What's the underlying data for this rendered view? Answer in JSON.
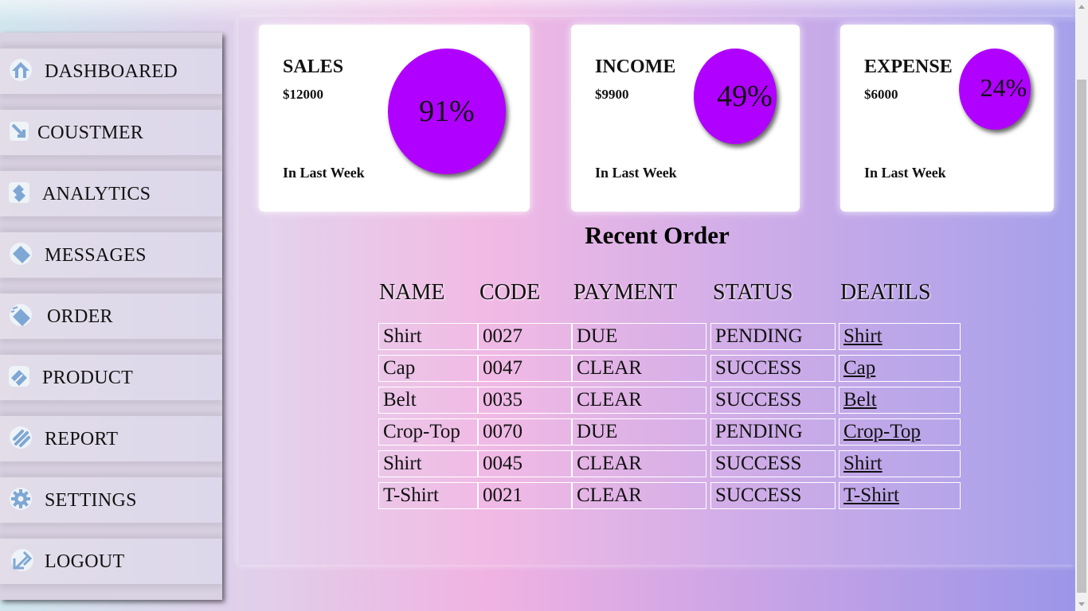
{
  "sidebar": {
    "items": [
      {
        "label": "DASHBOARED",
        "icon": "arrow-up-icon"
      },
      {
        "label": "COUSTMER",
        "icon": "arrow-down-right-icon"
      },
      {
        "label": "ANALYTICS",
        "icon": "stack-icon"
      },
      {
        "label": "MESSAGES",
        "icon": "tag-icon"
      },
      {
        "label": "ORDER",
        "icon": "ticket-icon"
      },
      {
        "label": "PRODUCT",
        "icon": "label-icon"
      },
      {
        "label": "REPORT",
        "icon": "stripes-icon"
      },
      {
        "label": "SETTINGS",
        "icon": "gear-icon"
      },
      {
        "label": "LOGOUT",
        "icon": "logout-arrow-icon"
      }
    ]
  },
  "cards": [
    {
      "title": "SALES",
      "amount": "$12000",
      "period": "In Last Week",
      "percent": "91%"
    },
    {
      "title": "INCOME",
      "amount": "$9900",
      "period": "In Last Week",
      "percent": "49%"
    },
    {
      "title": "EXPENSE",
      "amount": "$6000",
      "period": "In Last Week",
      "percent": "24%"
    }
  ],
  "orders": {
    "title": "Recent Order",
    "headers": [
      "NAME",
      "CODE",
      "PAYMENT",
      "STATUS",
      "DEATILS"
    ],
    "rows": [
      {
        "name": "Shirt",
        "code": "0027",
        "payment": "DUE",
        "status": "PENDING",
        "details": "Shirt"
      },
      {
        "name": "Cap",
        "code": "0047",
        "payment": "CLEAR",
        "status": "SUCCESS",
        "details": "Cap"
      },
      {
        "name": "Belt",
        "code": "0035",
        "payment": "CLEAR",
        "status": "SUCCESS",
        "details": "Belt"
      },
      {
        "name": "Crop-Top",
        "code": "0070",
        "payment": "DUE",
        "status": "PENDING",
        "details": "Crop-Top"
      },
      {
        "name": "Shirt",
        "code": "0045",
        "payment": "CLEAR",
        "status": "SUCCESS",
        "details": "Shirt"
      },
      {
        "name": "T-Shirt",
        "code": "0021",
        "payment": "CLEAR",
        "status": "SUCCESS",
        "details": "T-Shirt"
      }
    ]
  },
  "colors": {
    "accent_circle": "#b000ff",
    "card_background": "#ffffff"
  }
}
